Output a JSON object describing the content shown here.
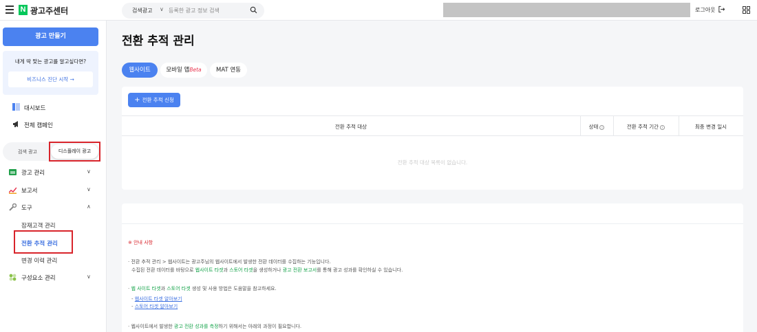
{
  "app": {
    "logo_letter": "N",
    "title": "광고주센터"
  },
  "search": {
    "type": "검색광고",
    "placeholder": "등록한 광고 정보 검색"
  },
  "header": {
    "logout": "로그아웃"
  },
  "sidebar": {
    "create_button": "광고 만들기",
    "promo_question": "내게 딱 맞는 광고를 알고싶다면?",
    "promo_button": "비즈니스 진단 시작 →",
    "dashboard": "대시보드",
    "all_campaigns": "전체 캠페인",
    "segment": {
      "left": "검색 광고",
      "right": "디스플레이 광고"
    },
    "menu": {
      "ad_management": "광고 관리",
      "reports": "보고서",
      "tools": "도구",
      "tools_sub": [
        "잠재고객 관리",
        "전환 추적 관리",
        "변경 이력 관리"
      ],
      "components": "구성요소 관리"
    }
  },
  "main": {
    "title": "전환 추적 관리",
    "tabs": {
      "web": "웹사이트",
      "mobile": "모바일 앱",
      "beta": "Beta",
      "mat": "MAT 연동"
    },
    "add_button": "전환 추적 신청",
    "table": {
      "col_target": "전환 추적 대상",
      "col_status": "상태",
      "col_period": "전환 추적 기간",
      "col_updated": "최종 변경 일시",
      "empty": "전환 추적 대상 목록이 없습니다."
    },
    "notice": {
      "title": "※ 안내 사항",
      "p1a": "· 전환 추적 관리 > 웹사이트는 광고주님의 웹사이트에서 발생한 전환 데이터를 수집하는 기능입니다.",
      "p1b_pre": "수집된 전환 데이터를 바탕으로 ",
      "p1b_g1": "웹사이트 타겟",
      "p1b_mid1": "과 ",
      "p1b_g2": "스토어 타겟",
      "p1b_mid2": "을 생성하거나 ",
      "p1b_g3": "광고 전환 보고서",
      "p1b_post": "를 통해 광고 성과를 확인하실 수 있습니다.",
      "p2_pre": "· ",
      "p2_g1": "웹 사이트 타겟",
      "p2_mid": "과 ",
      "p2_g2": "스토어 타겟",
      "p2_post": " 생성 및 사용 방법은 도움말을 참고하세요.",
      "link1": "웹사이트 타겟 알아보기",
      "link2": "스토어 타겟 알아보기",
      "p3_pre": "· 웹사이트에서 발생한 ",
      "p3_g": "광고 전환 성과를 측정",
      "p3_post": "하기 위해서는 아래의 과정이 필요합니다."
    }
  },
  "colors": {
    "primary": "#4b82f0",
    "highlight": "#d8232a",
    "brand": "#03c75a"
  }
}
